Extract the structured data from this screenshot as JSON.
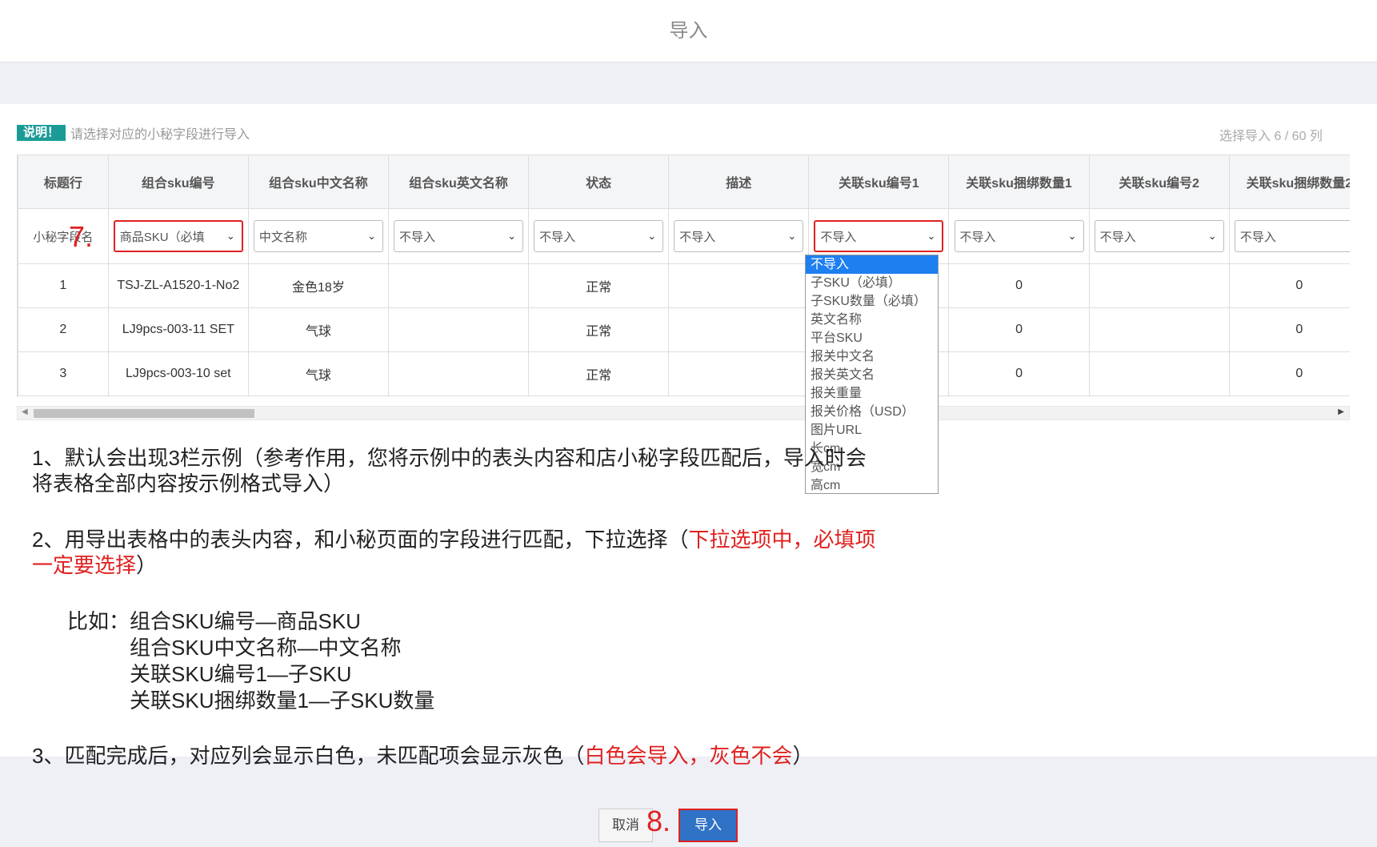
{
  "dialog": {
    "title": "导入"
  },
  "note": {
    "tag": "说明！",
    "text": "请选择对应的小秘字段进行导入",
    "count": "选择导入 6  / 60 列"
  },
  "table": {
    "headers": [
      "标题行",
      "组合sku编号",
      "组合sku中文名称",
      "组合sku英文名称",
      "状态",
      "描述",
      "关联sku编号1",
      "关联sku捆绑数量1",
      "关联sku编号2",
      "关联sku捆绑数量2"
    ],
    "map_label": "小秘字段名",
    "selects": [
      "商品SKU（必填",
      "中文名称",
      "不导入",
      "不导入",
      "不导入",
      "不导入",
      "不导入",
      "不导入",
      "不导入"
    ],
    "rows": [
      [
        "1",
        "TSJ-ZL-A1520-1-No2",
        "金色18岁",
        "",
        "正常",
        "",
        "",
        "0",
        "",
        "0"
      ],
      [
        "2",
        "LJ9pcs-003-11 SET",
        "气球",
        "",
        "正常",
        "",
        "",
        "0",
        "",
        "0"
      ],
      [
        "3",
        "LJ9pcs-003-10 set",
        "气球",
        "",
        "正常",
        "",
        "",
        "0",
        "",
        "0"
      ]
    ]
  },
  "dropdown": {
    "options": [
      "不导入",
      "子SKU（必填）",
      "子SKU数量（必填）",
      "英文名称",
      "平台SKU",
      "报关中文名",
      "报关英文名",
      "报关重量",
      "报关价格（USD）",
      "图片URL",
      "长cm",
      "宽cm",
      "高cm"
    ],
    "selected_index": 0
  },
  "steps": {
    "s7": "7.",
    "s8": "8."
  },
  "instructions": {
    "p1_line1": "1、默认会出现3栏示例（参考作用，您将示例中的表头内容和店小秘字段匹配后，导入时会",
    "p1_line2": "将表格全部内容按示例格式导入）",
    "p2_line1_black": "2、用导出表格中的表头内容，和小秘页面的字段进行匹配，下拉选择（",
    "p2_line1_red": "下拉选项中，必填项",
    "p2_line2_red": "一定要选择",
    "p2_line2_black": "）",
    "example_prefix": "比如：",
    "examples": [
      "组合SKU编号—商品SKU",
      "组合SKU中文名称—中文名称",
      "关联SKU编号1—子SKU",
      "关联SKU捆绑数量1—子SKU数量"
    ],
    "p3_black": "3、匹配完成后，对应列会显示白色，未匹配项会显示灰色（",
    "p3_red": "白色会导入，灰色不会",
    "p3_end": "）"
  },
  "buttons": {
    "cancel": "取消",
    "import": "导入"
  },
  "colors": {
    "accent_red": "#e02020",
    "primary_blue": "#2f72c6",
    "note_teal": "#1b9b96",
    "selected_option": "#1e7ff0"
  }
}
